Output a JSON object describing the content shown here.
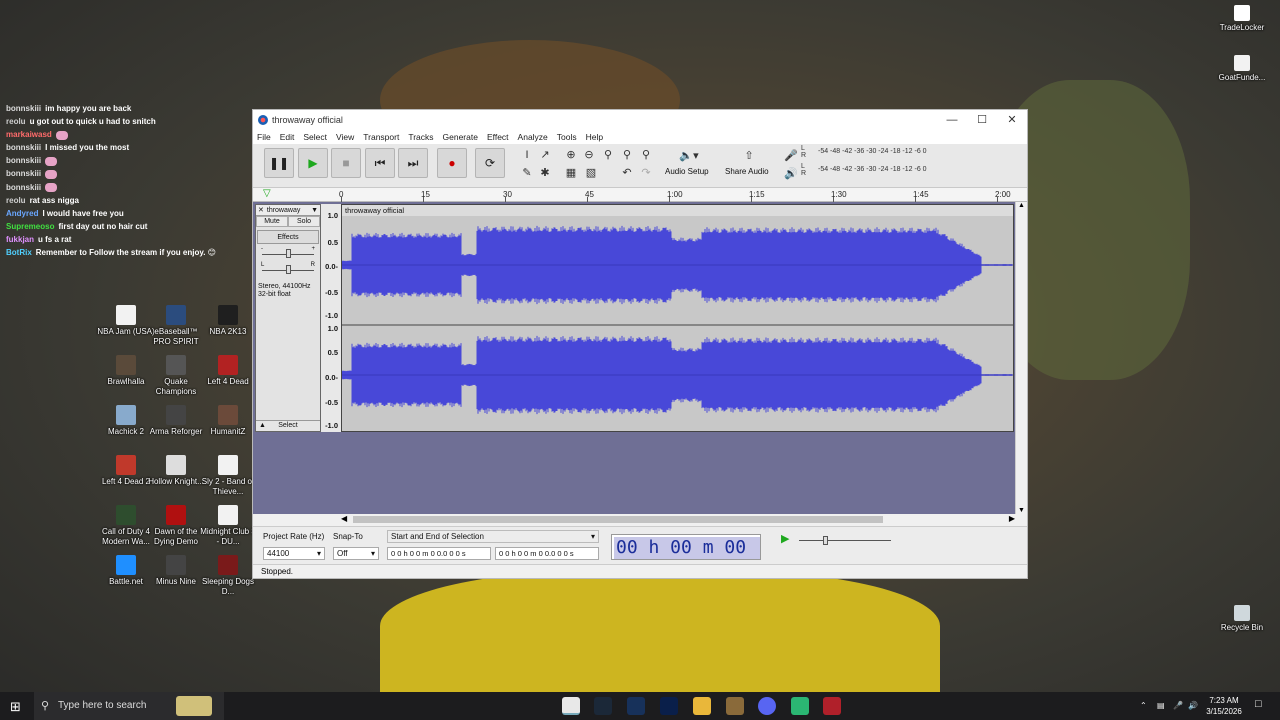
{
  "chat": [
    {
      "user": "bonnskiii",
      "color": "#dcdcdc",
      "text": "im happy you are back"
    },
    {
      "user": "reolu",
      "color": "#cfcfcf",
      "text": "u got out to quick u had to snitch"
    },
    {
      "user": "markaiwasd",
      "color": "#ff6b6b",
      "text": ""
    },
    {
      "user": "bonnskiii",
      "color": "#dcdcdc",
      "text": "I missed you the most"
    },
    {
      "user": "bonnskiii",
      "color": "#dcdcdc",
      "text": ""
    },
    {
      "user": "bonnskiii",
      "color": "#dcdcdc",
      "text": ""
    },
    {
      "user": "bonnskiii",
      "color": "#dcdcdc",
      "text": ""
    },
    {
      "user": "reolu",
      "color": "#cfcfcf",
      "text": "rat ass nigga"
    },
    {
      "user": "Andyred",
      "color": "#6aa7ff",
      "text": "I would have free you"
    },
    {
      "user": "Supremeoso",
      "color": "#40e040",
      "text": "first day out no hair cut"
    },
    {
      "user": "fukkjan",
      "color": "#e090ff",
      "text": "u fs a rat"
    },
    {
      "user": "BotRix",
      "color": "#50d0ff",
      "text": "Remember to Follow the stream if you enjoy. 😊"
    }
  ],
  "desktop_icons": [
    {
      "label": "NBA Jam (USA)",
      "color": "#f2f2f2"
    },
    {
      "label": "eBaseball™ PRO SPIRIT",
      "color": "#2b4c7e"
    },
    {
      "label": "NBA 2K13",
      "color": "#1f1f1f"
    },
    {
      "label": "Brawlhalla",
      "color": "#5a4a3a"
    },
    {
      "label": "Quake Champions",
      "color": "#555555"
    },
    {
      "label": "Left 4 Dead",
      "color": "#b22222"
    },
    {
      "label": "Machick 2",
      "color": "#88aacc"
    },
    {
      "label": "Arma Reforger",
      "color": "#444444"
    },
    {
      "label": "HumanitZ",
      "color": "#6b4a3a"
    },
    {
      "label": "Left 4 Dead 2",
      "color": "#c0392b"
    },
    {
      "label": "Hollow Knight...",
      "color": "#dddddd"
    },
    {
      "label": "Sly 2 - Band of Thieve...",
      "color": "#f2f2f2"
    },
    {
      "label": "Call of Duty 4 Modern Wa...",
      "color": "#2e4d2e"
    },
    {
      "label": "Dawn of the Dying Demo",
      "color": "#b01010"
    },
    {
      "label": "Midnight Club 3 - DU...",
      "color": "#f2f2f2"
    },
    {
      "label": "Battle.net",
      "color": "#1f8fff"
    },
    {
      "label": "Minus Nine",
      "color": "#444444"
    },
    {
      "label": "Sleeping Dogs D...",
      "color": "#7a1a1a"
    }
  ],
  "right_icons": [
    {
      "label": "TradeLocker",
      "color": "#ffffff"
    },
    {
      "label": "GoatFunde...",
      "color": "#f2f2f2"
    },
    {
      "label": "Recycle Bin",
      "color": "#cfd8dc"
    }
  ],
  "window": {
    "title": "throwaway official",
    "menu": [
      "File",
      "Edit",
      "Select",
      "View",
      "Transport",
      "Tracks",
      "Generate",
      "Effect",
      "Analyze",
      "Tools",
      "Help"
    ],
    "audio_setup": "Audio Setup",
    "share_audio": "Share Audio",
    "meter_ticks": "-54 -48 -42 -36 -30 -24 -18 -12 -6 0",
    "meter_L": "L",
    "meter_R": "R",
    "ruler": [
      "0",
      "15",
      "30",
      "45",
      "1:00",
      "1:15",
      "1:30",
      "1:45",
      "2:00"
    ],
    "track": {
      "name": "throwaway",
      "mute": "Mute",
      "solo": "Solo",
      "effects": "Effects",
      "info1": "Stereo, 44100Hz",
      "info2": "32-bit float",
      "select": "Select",
      "clip_name": "throwaway official",
      "y_labels": [
        "1.0",
        "0.5",
        "0.0-",
        "-0.5",
        "-1.0",
        "1.0",
        "0.5",
        "0.0-",
        "-0.5",
        "-1.0"
      ]
    },
    "bottom": {
      "project_rate_label": "Project Rate (Hz)",
      "project_rate": "44100",
      "snap_to_label": "Snap-To",
      "snap_to": "Off",
      "selection_label": "Start and End of Selection",
      "sel_start": "0 0 h 0 0 m 0 0.0 0 0 s",
      "sel_end": "0 0 h 0 0 m 0 0.0 0 0 s",
      "big_time": "00 h 00 m 00 s"
    },
    "status": "Stopped."
  },
  "taskbar": {
    "search_placeholder": "Type here to search",
    "time": "7:23 AM",
    "date": "3/15/2026"
  }
}
